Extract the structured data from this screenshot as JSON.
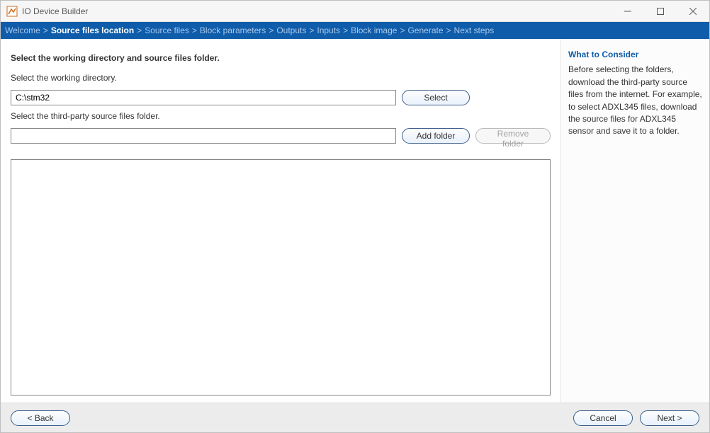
{
  "window": {
    "title": "IO Device Builder"
  },
  "breadcrumbs": {
    "items": [
      "Welcome",
      "Source files location",
      "Source files",
      "Block parameters",
      "Outputs",
      "Inputs",
      "Block image",
      "Generate",
      "Next steps"
    ],
    "active_index": 1
  },
  "main": {
    "heading": "Select the working directory and source files folder.",
    "workdir_label": "Select the working directory.",
    "workdir_value": "C:\\stm32",
    "select_btn": "Select",
    "srcfolder_label": "Select the third-party source files folder.",
    "srcfolder_value": "",
    "add_folder_btn": "Add folder",
    "remove_folder_btn": "Remove folder"
  },
  "side": {
    "title": "What to Consider",
    "body": "Before selecting the folders, download the third-party source files from the internet. For example, to select ADXL345 files,  download the source files for ADXL345 sensor and save it to a folder."
  },
  "footer": {
    "back": "< Back",
    "cancel": "Cancel",
    "next": "Next >"
  }
}
